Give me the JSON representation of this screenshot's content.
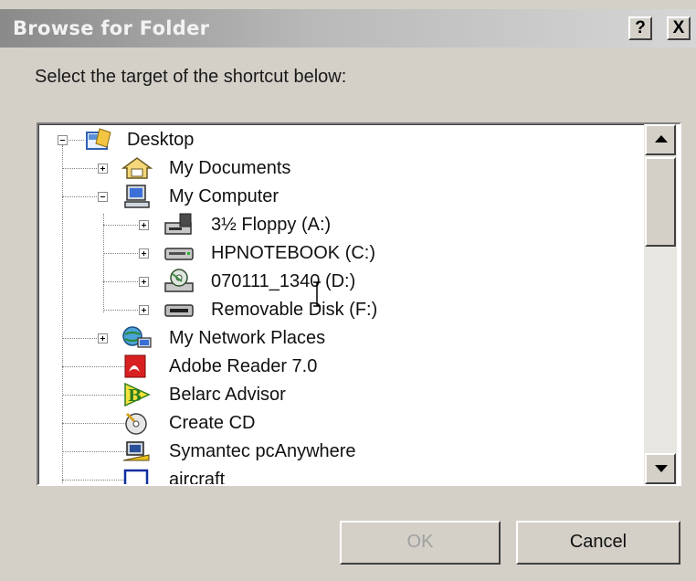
{
  "dialog": {
    "title": "Browse for Folder",
    "help_label": "?",
    "close_label": "X",
    "instruction": "Select the target of the shortcut below:",
    "ok_label": "OK",
    "cancel_label": "Cancel"
  },
  "tree": {
    "items": [
      {
        "label": "Desktop",
        "icon": "desktop-icon",
        "expander": "minus"
      },
      {
        "label": "My Documents",
        "icon": "my-documents-icon",
        "expander": "plus"
      },
      {
        "label": "My Computer",
        "icon": "my-computer-icon",
        "expander": "minus"
      },
      {
        "label": "3½ Floppy (A:)",
        "icon": "floppy-drive-icon",
        "expander": "plus"
      },
      {
        "label": "HPNOTEBOOK (C:)",
        "icon": "hard-drive-icon",
        "expander": "plus"
      },
      {
        "label": "070111_1340 (D:)",
        "icon": "cd-drive-icon",
        "expander": "plus"
      },
      {
        "label": "Removable Disk (F:)",
        "icon": "removable-disk-icon",
        "expander": "plus"
      },
      {
        "label": "My Network Places",
        "icon": "network-places-icon",
        "expander": "plus"
      },
      {
        "label": "Adobe Reader 7.0",
        "icon": "adobe-reader-icon",
        "expander": "none"
      },
      {
        "label": "Belarc Advisor",
        "icon": "belarc-advisor-icon",
        "expander": "none"
      },
      {
        "label": "Create CD",
        "icon": "create-cd-icon",
        "expander": "none"
      },
      {
        "label": "Symantec pcAnywhere",
        "icon": "pcanywhere-icon",
        "expander": "none"
      },
      {
        "label": "aircraft",
        "icon": "folder-outline-icon",
        "expander": "none"
      }
    ]
  },
  "colors": {
    "dialog_bg": "#d4d0c8",
    "titlebar_inactive": "#9a9a9a",
    "tree_bg": "#ffffff",
    "disabled_text": "#a0a0a0"
  }
}
